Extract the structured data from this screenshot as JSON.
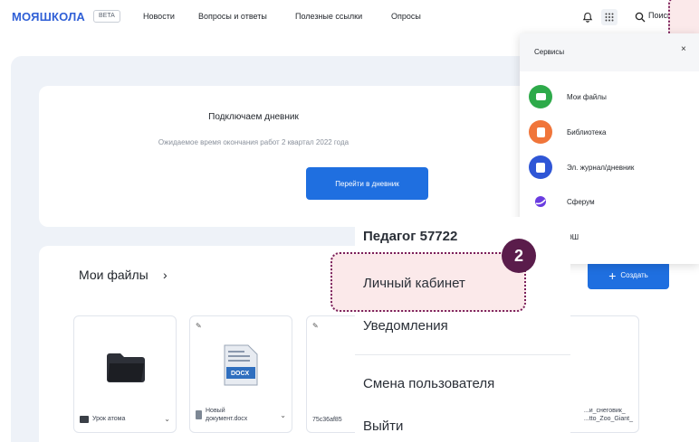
{
  "header": {
    "logo": "МОЯШКОЛА",
    "beta": "BETA",
    "nav": [
      "Новости",
      "Вопросы и ответы",
      "Полезные ссылки",
      "Опросы"
    ],
    "search_label": "Поиск"
  },
  "diary": {
    "title": "Подключаем дневник",
    "subtitle": "Ожидаемое время окончания работ 2 квартал 2022 года",
    "button": "Перейти в дневник"
  },
  "files": {
    "title": "Мои файлы",
    "chevron": "›",
    "create_label": "Создать",
    "tiles": [
      {
        "name": "Урок атома"
      },
      {
        "name": "Новый документ.docx",
        "line1": "Новый",
        "line2": "документ.docx",
        "badge": "DOCX"
      },
      {
        "name": "75c36af85"
      },
      {
        "line1": "...и_снеговик_",
        "line2": "...tto_Zoo_Giant_"
      }
    ]
  },
  "services": {
    "title": "Сервисы",
    "close": "×",
    "items": [
      {
        "label": "Мои файлы",
        "color": "#2eaa4a",
        "icon": "folder-icon"
      },
      {
        "label": "Библиотека",
        "color": "#f0753a",
        "icon": "book-icon"
      },
      {
        "label": "Эл. журнал/дневник",
        "color": "#2f56d6",
        "icon": "journal-icon"
      },
      {
        "label": "Сферум",
        "color": "#6a3ce0",
        "icon": "sferum-icon"
      },
      {
        "label": "ЭШ",
        "color": "#1f6fe0",
        "icon": "esh-icon"
      }
    ]
  },
  "user_menu": {
    "name": "Педагог 57722",
    "items": [
      "Личный кабинет",
      "Уведомления",
      "Смена пользователя",
      "Выйти"
    ]
  },
  "step_badge": "2",
  "colors": {
    "accent": "#1f6fe0",
    "highlight_border": "#7a1f5a",
    "badge_bg": "#5a1c4b"
  }
}
